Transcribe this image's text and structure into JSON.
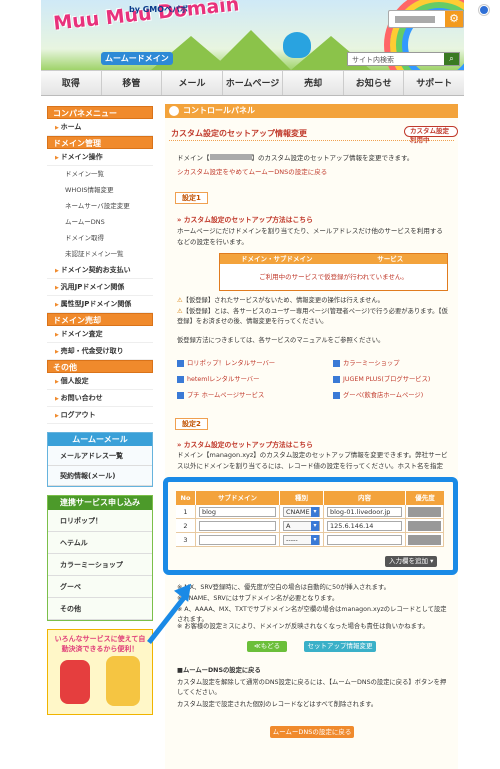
{
  "header": {
    "logo": "Muu Muu Domain",
    "logo_sub": "ムームードメイン",
    "gmo": "by GMOペパボ",
    "search_placeholder": "サイト内検索"
  },
  "nav": [
    "取得",
    "移管",
    "メール",
    "ホームページ",
    "売却",
    "お知らせ",
    "サポート"
  ],
  "sidebar": {
    "control_menu": "コンパネメニュー",
    "home": "ホーム",
    "domain_manage": "ドメイン管理",
    "domain_ops": "ドメイン操作",
    "domain_ops_items": [
      "ドメイン一覧",
      "WHOIS情報変更",
      "ネームサーバ設定変更",
      "ムームーDNS",
      "ドメイン取得",
      "未認証ドメイン一覧"
    ],
    "items1": [
      "ドメイン契約お支払い",
      "汎用JPドメイン関係",
      "属性型JPドメイン関係"
    ],
    "domain_sale": "ドメイン売却",
    "items2": [
      "ドメイン査定",
      "売却・代金受け取り"
    ],
    "other": "その他",
    "items3": [
      "個人設定",
      "お問い合わせ",
      "ログアウト"
    ],
    "mail_head": "ムームーメール",
    "mail_items": [
      "メールアドレス一覧",
      "契約情報(メール)"
    ],
    "link_head": "連携サービス申し込み",
    "link_items": [
      "ロリポップ！",
      "ヘテムル",
      "カラーミーショップ",
      "グーペ",
      "その他"
    ],
    "banner": "いろんなサービスに使えて自動決済できるから便利！"
  },
  "main": {
    "panel_title": "コントロールパネル",
    "subtitle": "カスタム設定のセットアップ情報変更",
    "badge": "カスタム設定利用中",
    "intro_a": "ドメイン【",
    "intro_b": "】のカスタム設定のセットアップ情報を変更できます。",
    "intro_link": "シカスタム設定をやめてムームーDNSの設定に戻る",
    "setting1": "設定1",
    "setting1_link": "» カスタム設定のセットアップ方法はこちら",
    "setting1_desc": "ホームページにだけドメインを割り当てたり、メールアドレスだけ他のサービスを利用するなどの設定を行います。",
    "t1_h1": "ドメイン・サブドメイン",
    "t1_h2": "サービス",
    "t1_empty": "ご利用中のサービスで仮登録が行われていません。",
    "warn1": "【仮登録】されたサービスがないため、情報変更の操作は行えません。",
    "warn2": "【仮登録】とは、各サービスのユーザー専用ページ(管理者ページ)で行う必要があります。【仮登録】をお済ませの後、情報変更を行ってください。",
    "manual": "仮登録方法につきましては、各サービスのマニュアルをご参照ください。",
    "services": [
      "ロリポップ！レンタルサーバー",
      "カラーミーショップ",
      "hetemlレンタルサーバー",
      "JUGEM PLUS(ブログサービス)",
      "プチ ホームページサービス",
      "グーペ(飲食店ホームページ)"
    ],
    "setting2": "設定2",
    "setting2_link": "» カスタム設定のセットアップ方法はこちら",
    "setting2_desc": "ドメイン【managon.xyz】のカスタム設定のセットアップ情報を変更できます。弊社サービス以外にドメインを割り当てるには、レコード値の設定を行ってください。ホスト名を指定",
    "dns_headers": [
      "No",
      "サブドメイン",
      "種別",
      "内容",
      "優先度"
    ],
    "dns_rows": [
      {
        "no": "1",
        "sub": "blog",
        "type": "CNAME",
        "content": "blog-01.livedoor.jp"
      },
      {
        "no": "2",
        "sub": "",
        "type": "A",
        "content": "125.6.146.14"
      },
      {
        "no": "3",
        "sub": "",
        "type": "-----",
        "content": ""
      }
    ],
    "add_row": "入力欄を追加 ▾",
    "note1": "※ MX、SRV登録時に、優先度が空白の場合は自動的に50が挿入されます。",
    "note2": "※ CNAME、SRVにはサブドメイン名が必要となります。",
    "note3": "※ A、AAAA、MX、TXTでサブドメイン名が空欄の場合はmanagon.xyzのレコードとして設定されます。",
    "note4": "※ お客様の設定ミスにより、ドメインが反映されなくなった場合も責任は負いかねます。",
    "back": "≪もどる",
    "go": "セットアップ情報変更",
    "reset_title": "■ムームーDNSの設定に戻る",
    "reset_desc": "カスタム設定を解除して通常のDNS設定に戻るには、【ムームーDNSの設定に戻る】ボタンを押してください。",
    "reset_note": "カスタム設定で設定された個別のレコードなどはすべて削除されます。",
    "reset_btn": "ムームーDNSの設定に戻る"
  }
}
